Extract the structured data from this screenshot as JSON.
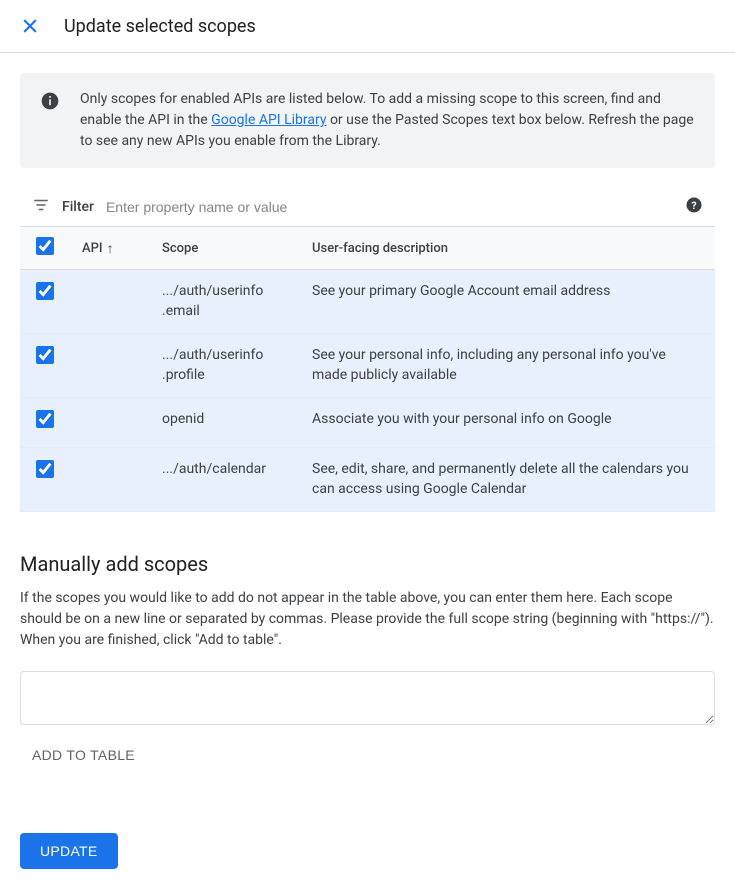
{
  "header": {
    "title": "Update selected scopes"
  },
  "banner": {
    "text_before_link": "Only scopes for enabled APIs are listed below. To add a missing scope to this screen, find and enable the API in the ",
    "link_text": "Google API Library",
    "text_after_link": " or use the Pasted Scopes text box below. Refresh the page to see any new APIs you enable from the Library."
  },
  "filter": {
    "label": "Filter",
    "placeholder": "Enter property name or value"
  },
  "table": {
    "headers": {
      "api": "API",
      "scope": "Scope",
      "description": "User-facing description"
    },
    "rows": [
      {
        "checked": true,
        "api": "",
        "scope": ".../auth/userinfo.email",
        "description": "See your primary Google Account email address"
      },
      {
        "checked": true,
        "api": "",
        "scope": ".../auth/userinfo.profile",
        "description": "See your personal info, including any personal info you've made publicly available"
      },
      {
        "checked": true,
        "api": "",
        "scope": "openid",
        "description": "Associate you with your personal info on Google"
      },
      {
        "checked": true,
        "api": "",
        "scope": ".../auth/calendar",
        "description": "See, edit, share, and permanently delete all the calendars you can access using Google Calendar"
      }
    ]
  },
  "manual": {
    "title": "Manually add scopes",
    "description": "If the scopes you would like to add do not appear in the table above, you can enter them here. Each scope should be on a new line or separated by commas. Please provide the full scope string (beginning with \"https://\"). When you are finished, click \"Add to table\".",
    "add_button": "ADD TO TABLE"
  },
  "footer": {
    "update_button": "UPDATE"
  }
}
